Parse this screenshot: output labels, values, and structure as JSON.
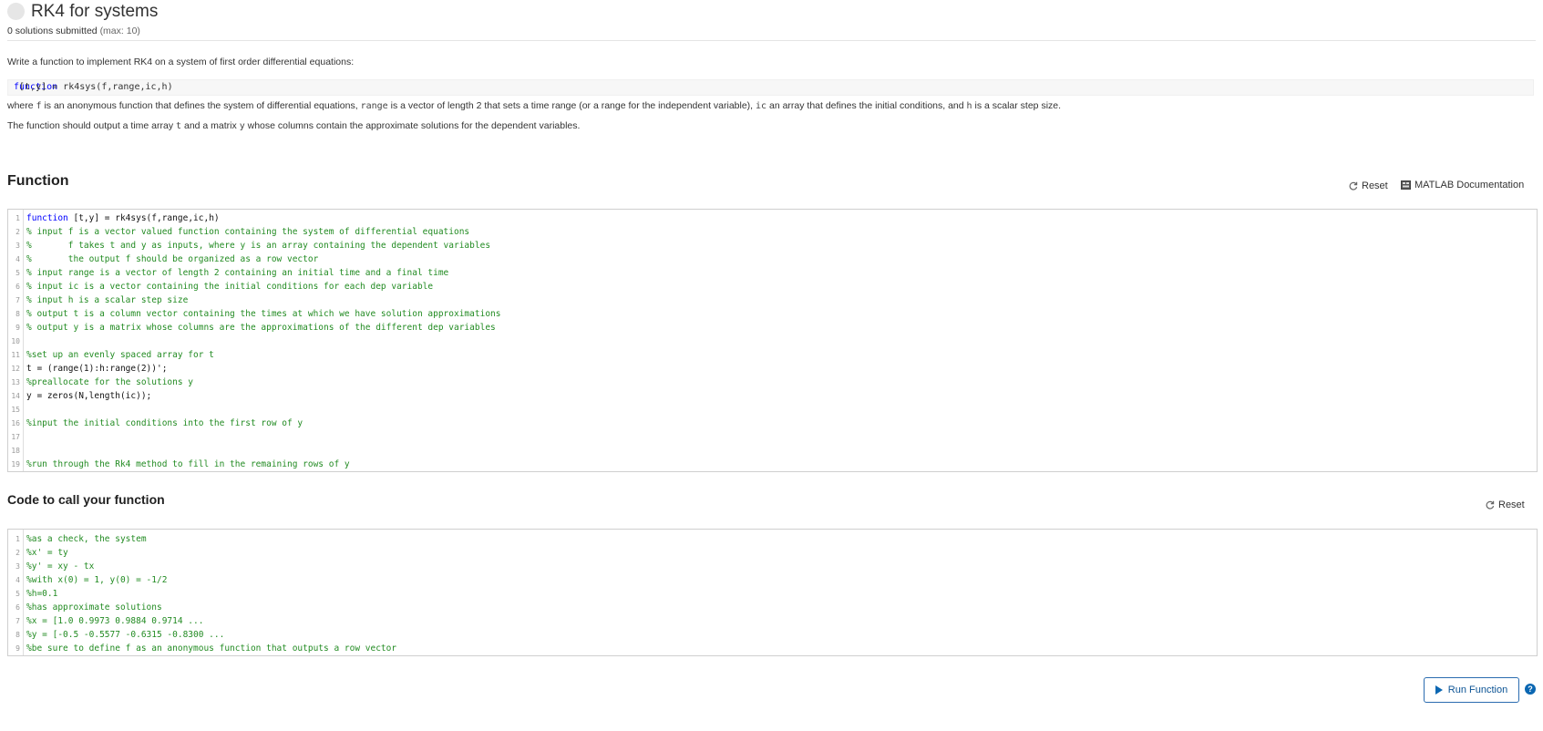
{
  "header": {
    "title": "RK4 for systems",
    "submissions": "0 solutions submitted",
    "max": "(max: 10)"
  },
  "description": {
    "intro": "Write a function to implement RK4 on a system of first order differential equations:",
    "signature_keyword": "function",
    "signature_rest": " [t,y] = rk4sys(f,range,ic,h)",
    "p2": [
      {
        "t": "where ",
        "code": false
      },
      {
        "t": "f",
        "code": true
      },
      {
        "t": " is an anonymous function that defines the system of differential equations, ",
        "code": false
      },
      {
        "t": "range",
        "code": true
      },
      {
        "t": " is a vector of length 2 that sets a time range (or a range for the independent variable), ",
        "code": false
      },
      {
        "t": "ic",
        "code": true
      },
      {
        "t": " an array that defines the initial conditions, and ",
        "code": false
      },
      {
        "t": "h",
        "code": true
      },
      {
        "t": " is a scalar step size.",
        "code": false
      }
    ],
    "p3": [
      {
        "t": "The function should output a time array ",
        "code": false
      },
      {
        "t": "t",
        "code": true
      },
      {
        "t": " and a matrix ",
        "code": false
      },
      {
        "t": "y",
        "code": true
      },
      {
        "t": " whose columns contain the approximate solutions for the dependent variables.",
        "code": false
      }
    ]
  },
  "function_section": {
    "title": "Function",
    "reset_label": "Reset",
    "doc_label": "MATLAB Documentation",
    "lines": [
      {
        "n": "1",
        "kw": "function",
        "text": " [t,y] = rk4sys(f,range,ic,h)",
        "type": "code"
      },
      {
        "n": "2",
        "text": "% input f is a vector valued function containing the system of differential equations",
        "type": "comment"
      },
      {
        "n": "3",
        "text": "%       f takes t and y as inputs, where y is an array containing the dependent variables",
        "type": "comment"
      },
      {
        "n": "4",
        "text": "%       the output f should be organized as a row vector",
        "type": "comment"
      },
      {
        "n": "5",
        "text": "% input range is a vector of length 2 containing an initial time and a final time",
        "type": "comment"
      },
      {
        "n": "6",
        "text": "% input ic is a vector containing the initial conditions for each dep variable",
        "type": "comment"
      },
      {
        "n": "7",
        "text": "% input h is a scalar step size",
        "type": "comment"
      },
      {
        "n": "8",
        "text": "% output t is a column vector containing the times at which we have solution approximations",
        "type": "comment"
      },
      {
        "n": "9",
        "text": "% output y is a matrix whose columns are the approximations of the different dep variables",
        "type": "comment"
      },
      {
        "n": "10",
        "text": "",
        "type": "code"
      },
      {
        "n": "11",
        "text": "%set up an evenly spaced array for t",
        "type": "comment"
      },
      {
        "n": "12",
        "text": "t = (range(1):h:range(2))';",
        "type": "code"
      },
      {
        "n": "13",
        "text": "%preallocate for the solutions y",
        "type": "comment"
      },
      {
        "n": "14",
        "text": "y = zeros(N,length(ic));",
        "type": "code"
      },
      {
        "n": "15",
        "text": "",
        "type": "code"
      },
      {
        "n": "16",
        "text": "%input the initial conditions into the first row of y",
        "type": "comment"
      },
      {
        "n": "17",
        "text": "",
        "type": "code"
      },
      {
        "n": "18",
        "text": "",
        "type": "code"
      },
      {
        "n": "19",
        "text": "%run through the Rk4 method to fill in the remaining rows of y",
        "type": "comment"
      }
    ]
  },
  "call_section": {
    "title": "Code to call your function",
    "reset_label": "Reset",
    "lines": [
      {
        "n": "1",
        "text": "%as a check, the system",
        "type": "comment"
      },
      {
        "n": "2",
        "text": "%x' = ty",
        "type": "comment"
      },
      {
        "n": "3",
        "text": "%y' = xy - tx",
        "type": "comment"
      },
      {
        "n": "4",
        "text": "%with x(0) = 1, y(0) = -1/2",
        "type": "comment"
      },
      {
        "n": "5",
        "text": "%h=0.1",
        "type": "comment"
      },
      {
        "n": "6",
        "text": "%has approximate solutions",
        "type": "comment"
      },
      {
        "n": "7",
        "text": "%x = [1.0 0.9973 0.9884 0.9714 ...",
        "type": "comment"
      },
      {
        "n": "8",
        "text": "%y = [-0.5 -0.5577 -0.6315 -0.8300 ...",
        "type": "comment"
      },
      {
        "n": "9",
        "text": "%be sure to define f as an anonymous function that outputs a row vector",
        "type": "comment"
      }
    ]
  },
  "run_button_label": "Run Function",
  "help_glyph": "?",
  "colors": {
    "comment": "#228b22",
    "keyword": "#0000ff",
    "button_border": "#2b6cb0",
    "button_text": "#0b5394"
  },
  "icons": [
    "status-circle-icon",
    "reset-icon",
    "matlab-doc-icon",
    "play-icon",
    "help-icon"
  ]
}
